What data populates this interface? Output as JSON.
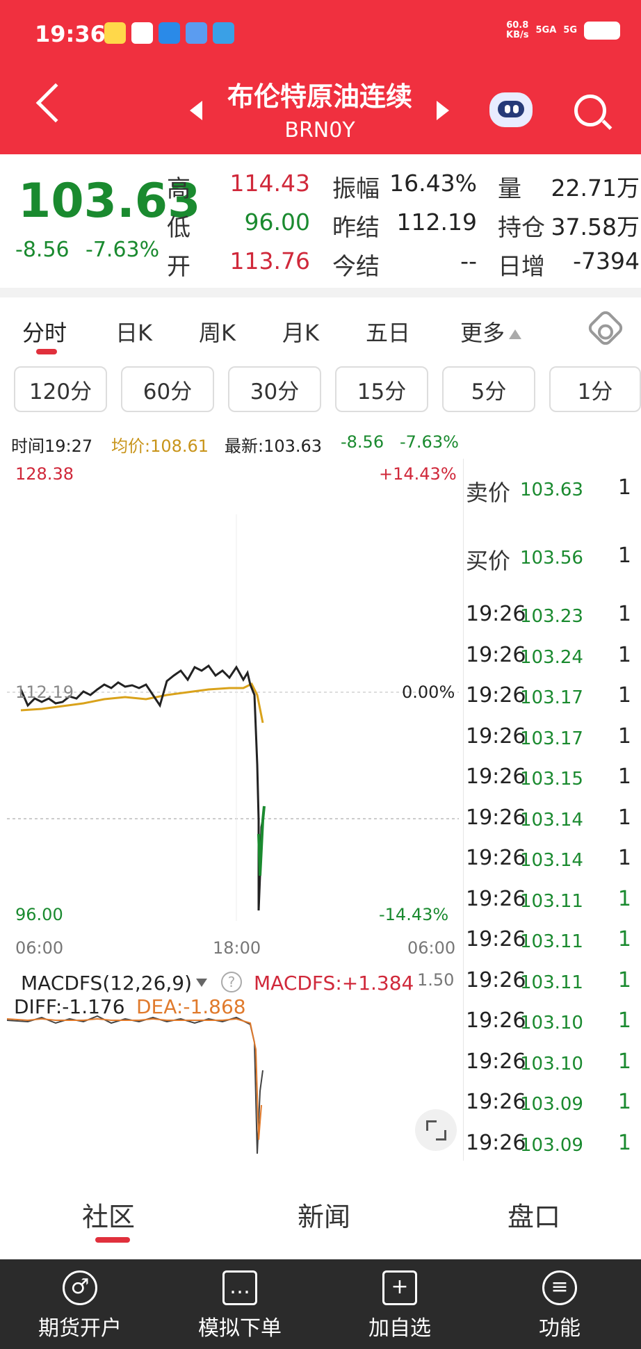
{
  "status_bar": {
    "time": "19:36",
    "net_speed": "60.8",
    "net_unit": "KB/s",
    "sig1": "5GA",
    "sig2": "5G"
  },
  "header": {
    "title": "布伦特原油连续",
    "code": "BRN0Y",
    "back_icon": "back-arrow-icon",
    "robot_icon": "robot-icon",
    "search_icon": "search-icon"
  },
  "quote": {
    "price": "103.63",
    "change": "-8.56",
    "change_pct": "-7.63%",
    "high_label": "高",
    "high": "114.43",
    "low_label": "低",
    "low": "96.00",
    "open_label": "开",
    "open": "113.76",
    "amp_label": "振幅",
    "amp": "16.43%",
    "prev_label": "昨结",
    "prev": "112.19",
    "today_label": "今结",
    "today": "--",
    "vol_label": "量",
    "vol": "22.71万",
    "oi_label": "持仓",
    "oi": "37.58万",
    "inc_label": "日增",
    "inc": "-7394"
  },
  "tabs": [
    "分时",
    "日K",
    "周K",
    "月K",
    "五日",
    "更多"
  ],
  "periods": [
    "120分",
    "60分",
    "30分",
    "15分",
    "5分",
    "1分"
  ],
  "info": {
    "time": "时间19:27",
    "avg": "均价:108.61",
    "latest": "最新:103.63",
    "chg": "-8.56",
    "pct": "-7.63%"
  },
  "chart_labels": {
    "y_max": "128.38",
    "y_max_pct": "+14.43%",
    "y_mid": "112.19",
    "y_mid_pct": "0.00%",
    "y_min": "96.00",
    "y_min_pct": "-14.43%",
    "x_ticks": [
      "06:00",
      "18:00",
      "06:00"
    ]
  },
  "macd": {
    "title": "MACDFS(12,26,9)",
    "value": "MACDFS:+1.384",
    "diff": "DIFF:-1.176",
    "dea": "DEA:-1.868",
    "scale": "1.50"
  },
  "book": {
    "ask_label": "卖价",
    "ask": "103.63",
    "ask_qty": "1",
    "bid_label": "买价",
    "bid": "103.56",
    "bid_qty": "1"
  },
  "trades": [
    {
      "t": "19:26",
      "p": "103.23",
      "q": "1",
      "qc": "dark"
    },
    {
      "t": "19:26",
      "p": "103.24",
      "q": "1",
      "qc": "dark"
    },
    {
      "t": "19:26",
      "p": "103.17",
      "q": "1",
      "qc": "dark"
    },
    {
      "t": "19:26",
      "p": "103.17",
      "q": "1",
      "qc": "dark"
    },
    {
      "t": "19:26",
      "p": "103.15",
      "q": "1",
      "qc": "dark"
    },
    {
      "t": "19:26",
      "p": "103.14",
      "q": "1",
      "qc": "dark"
    },
    {
      "t": "19:26",
      "p": "103.14",
      "q": "1",
      "qc": "dark"
    },
    {
      "t": "19:26",
      "p": "103.11",
      "q": "1",
      "qc": "green"
    },
    {
      "t": "19:26",
      "p": "103.11",
      "q": "1",
      "qc": "green"
    },
    {
      "t": "19:26",
      "p": "103.11",
      "q": "1",
      "qc": "green"
    },
    {
      "t": "19:26",
      "p": "103.10",
      "q": "1",
      "qc": "green"
    },
    {
      "t": "19:26",
      "p": "103.10",
      "q": "1",
      "qc": "green"
    },
    {
      "t": "19:26",
      "p": "103.09",
      "q": "1",
      "qc": "green"
    },
    {
      "t": "19:26",
      "p": "103.09",
      "q": "1",
      "qc": "green"
    }
  ],
  "sections": [
    "社区",
    "新闻",
    "盘口"
  ],
  "bottom_bar": [
    {
      "label": "期货开户",
      "icon": "account-icon",
      "glyph": "♂"
    },
    {
      "label": "模拟下单",
      "icon": "document-icon",
      "glyph": "…"
    },
    {
      "label": "加自选",
      "icon": "add-icon",
      "glyph": "+"
    },
    {
      "label": "功能",
      "icon": "menu-icon",
      "glyph": "≡"
    }
  ],
  "colors": {
    "header": "#f0303f",
    "up": "#d0283a",
    "down": "#1a8a2f",
    "avg_line": "#d9a21b"
  }
}
